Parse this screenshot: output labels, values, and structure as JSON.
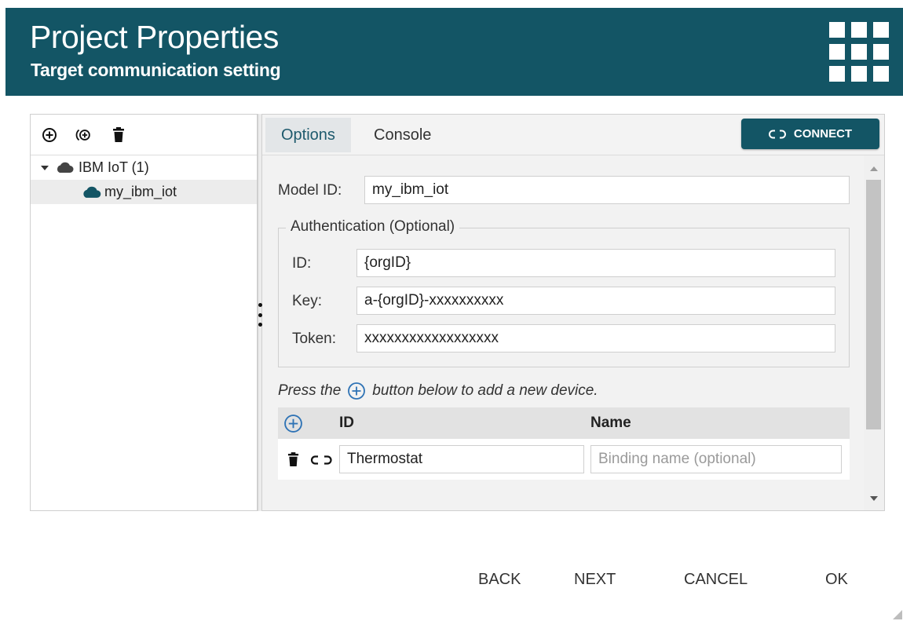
{
  "header": {
    "title": "Project Properties",
    "subtitle": "Target communication setting",
    "menu_icon": "grid-icon"
  },
  "sidebar": {
    "toolbar": [
      {
        "icon": "add-circle-icon"
      },
      {
        "icon": "add-broadcast-icon"
      },
      {
        "icon": "trash-icon"
      }
    ],
    "tree": {
      "group_label": "IBM IoT (1)",
      "group_icon": "cloud-icon",
      "items": [
        {
          "label": "my_ibm_iot",
          "icon": "cloud-icon",
          "selected": true
        }
      ]
    }
  },
  "tabs": [
    {
      "label": "Options",
      "active": true
    },
    {
      "label": "Console",
      "active": false
    }
  ],
  "connect_button": {
    "label": "CONNECT",
    "icon": "link-icon"
  },
  "form": {
    "model_id_label": "Model ID:",
    "model_id_value": "my_ibm_iot",
    "auth_legend": "Authentication (Optional)",
    "id_label": "ID:",
    "id_value": "{orgID}",
    "key_label": "Key:",
    "key_value": "a-{orgID}-xxxxxxxxxx",
    "token_label": "Token:",
    "token_value": "xxxxxxxxxxxxxxxxxx",
    "hint_prefix": "Press the",
    "hint_suffix": "button below to add a new device."
  },
  "devices_table": {
    "columns": [
      "ID",
      "Name"
    ],
    "rows": [
      {
        "id": "Thermostat",
        "name": "",
        "name_placeholder": "Binding name (optional)"
      }
    ]
  },
  "footer": {
    "back_label": "BACK",
    "next_label": "NEXT",
    "cancel_label": "CANCEL",
    "ok_label": "OK"
  },
  "colors": {
    "header_bg": "#135565",
    "accent": "#1e5a6d",
    "add_icon_blue": "#2f73b5"
  }
}
